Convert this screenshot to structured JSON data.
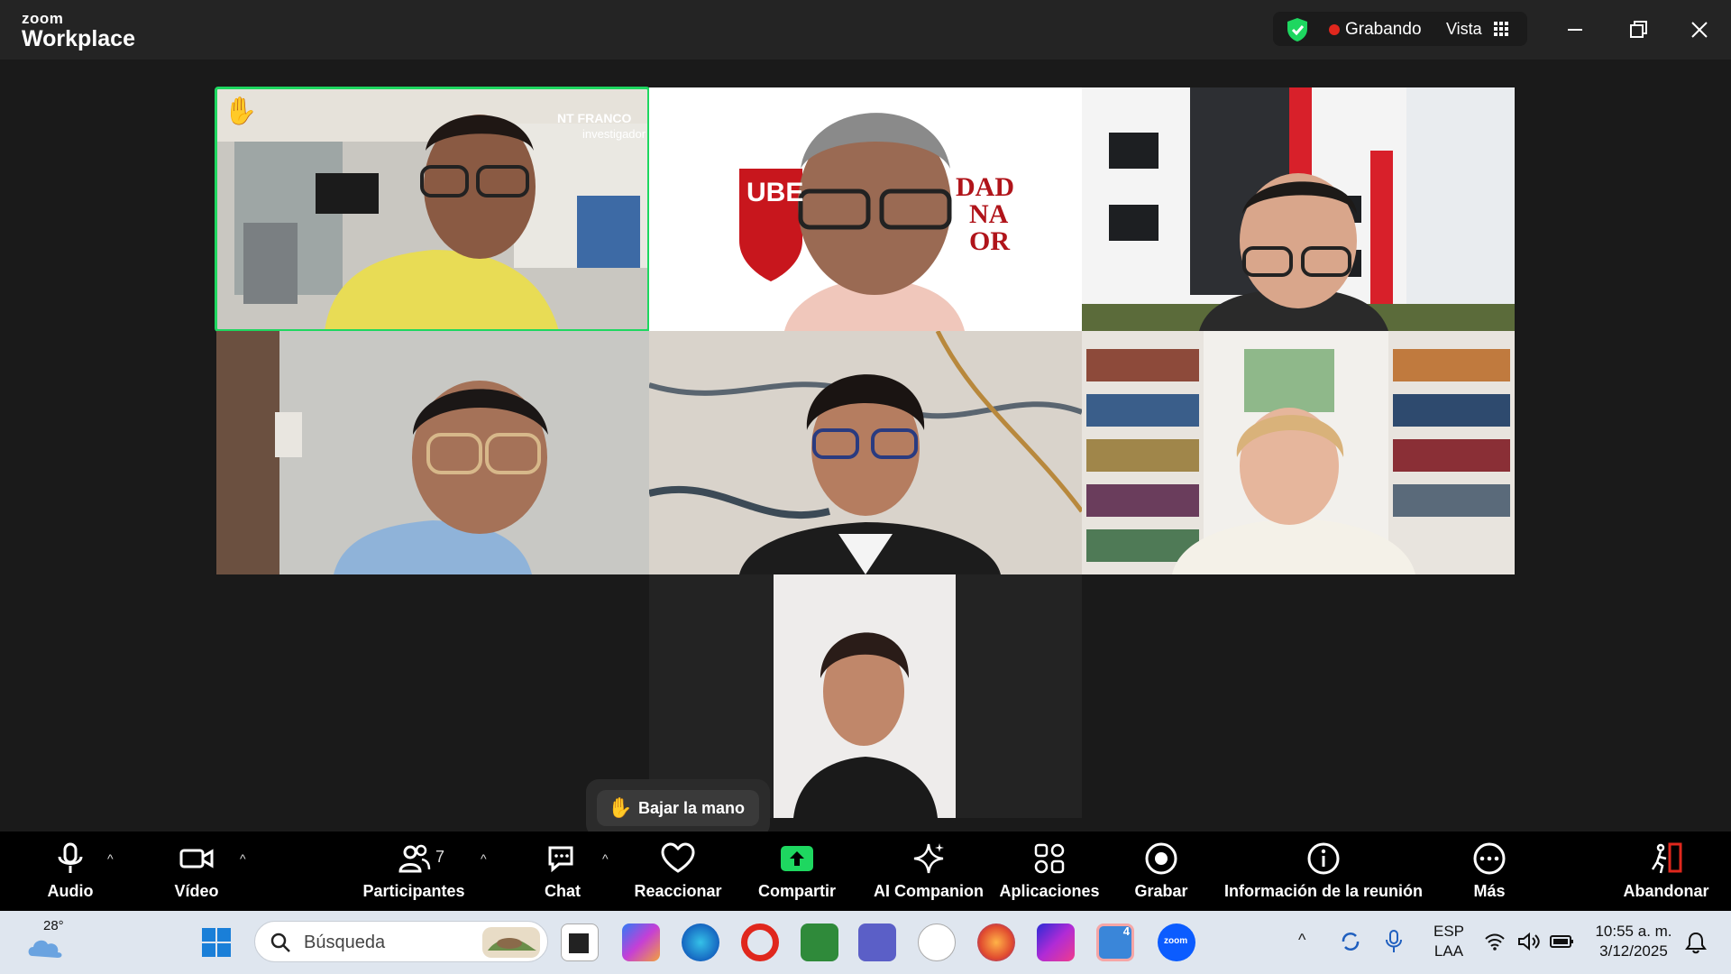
{
  "app": {
    "brand_top": "zoom",
    "brand_bottom": "Workplace"
  },
  "header": {
    "recording_label": "Grabando",
    "view_label": "Vista"
  },
  "tiles": {
    "t1_overlay_name": "NT FRANCO",
    "t1_overlay_role": "investigador",
    "t2_logo_text": "UBE"
  },
  "tooltip": {
    "lower_hand": "Bajar la mano"
  },
  "toolbar": {
    "audio": "Audio",
    "video": "Vídeo",
    "participants": "Participantes",
    "participants_count": "7",
    "chat": "Chat",
    "react": "Reaccionar",
    "share": "Compartir",
    "ai": "AI Companion",
    "apps": "Aplicaciones",
    "record": "Grabar",
    "info": "Información de la reunión",
    "more": "Más",
    "leave": "Abandonar"
  },
  "taskbar": {
    "weather_temp": "28°",
    "search_placeholder": "Búsqueda",
    "lang_top": "ESP",
    "lang_bottom": "LAA",
    "time": "10:55 a. m.",
    "date": "3/12/2025",
    "teams_badge": "4"
  },
  "colors": {
    "active_speaker": "#1ed760",
    "share_green": "#1ed760",
    "recording_dot": "#e0271d"
  }
}
